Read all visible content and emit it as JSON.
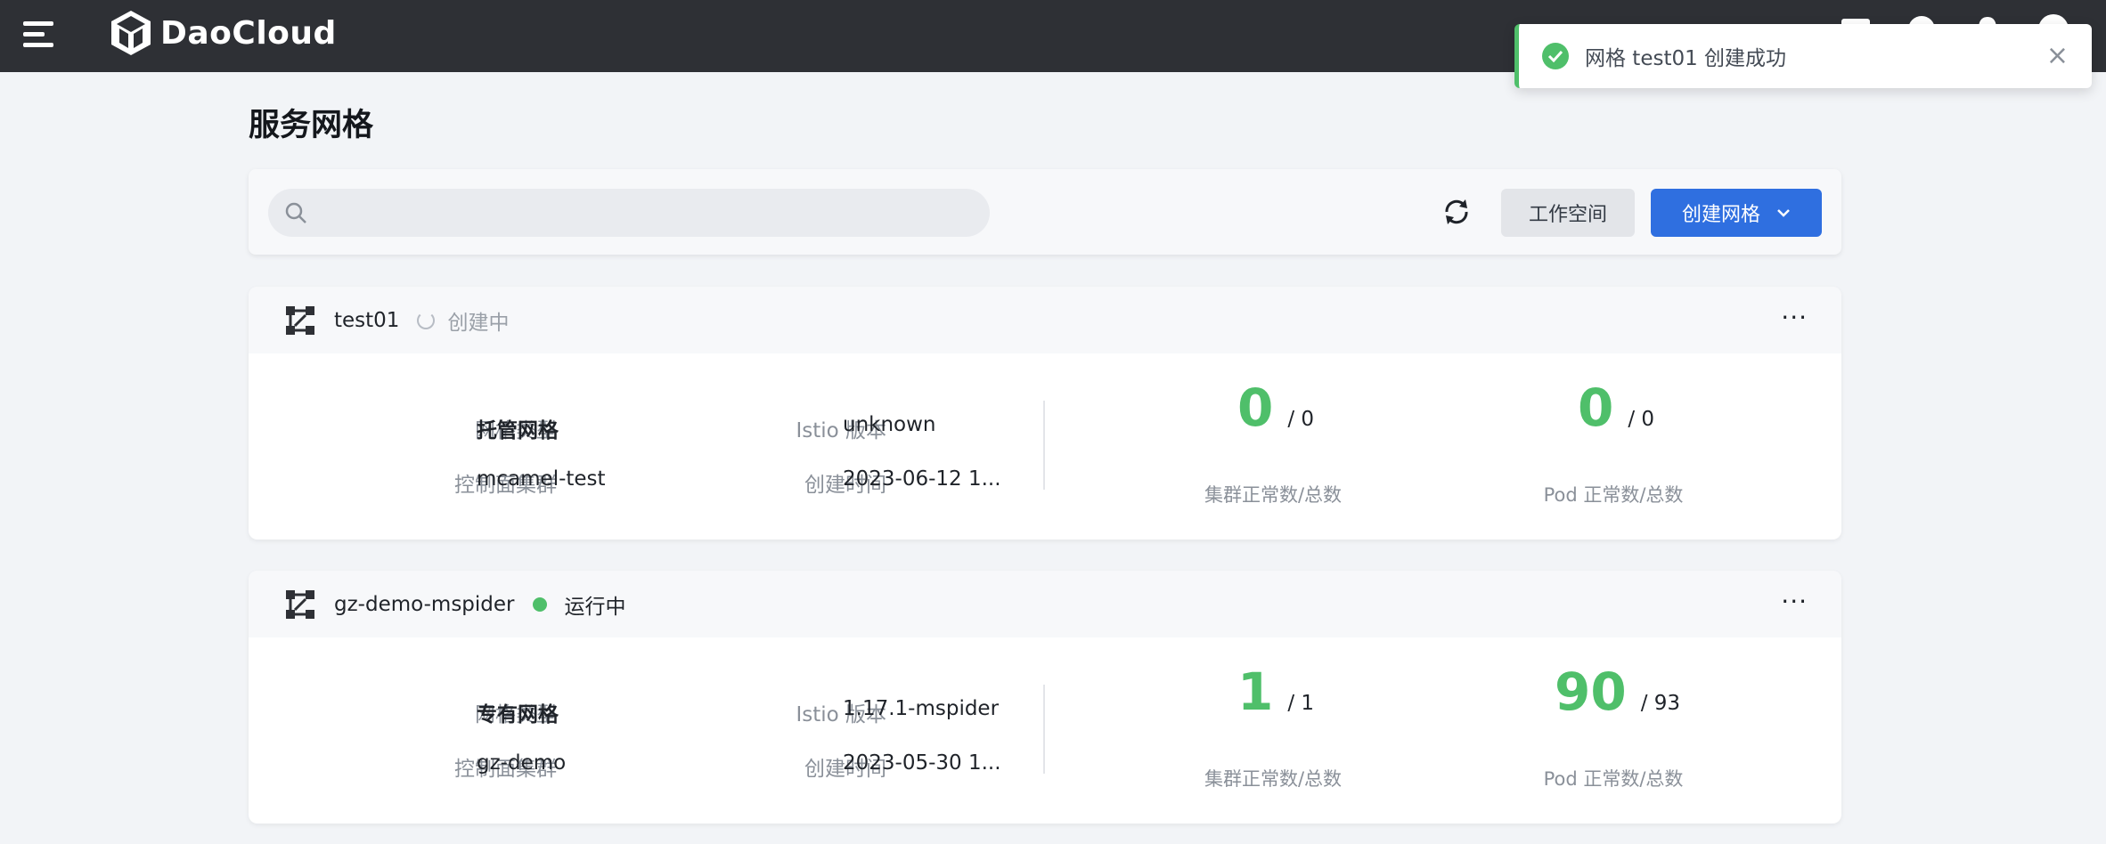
{
  "app": {
    "logo_text": "DaoCloud",
    "icons": [
      "menu-icon",
      "message-icon",
      "help-icon",
      "notification-icon",
      "user-avatar-icon"
    ]
  },
  "toast": {
    "message": "网格 test01 创建成功",
    "close": "×",
    "icon": "check-circle-icon"
  },
  "page": {
    "title": "服务网格"
  },
  "toolbar": {
    "search_placeholder": "",
    "workspace_label": "工作空间",
    "create_label": "创建网格",
    "refresh_icon": "refresh-icon"
  },
  "labels": {
    "mesh_type": "网格类型",
    "istio_version": "Istio 版本",
    "control_cluster": "控制面集群",
    "create_time": "创建时间",
    "cluster_ratio": "集群正常数/总数",
    "pod_ratio": "Pod 正常数/总数"
  },
  "meshes": [
    {
      "name": "test01",
      "status": "创建中",
      "mesh_type": "托管网格",
      "istio_version": "unknown",
      "control_cluster": "mcamel-test",
      "create_time": "2023-06-12 1...",
      "cluster_ok": "0",
      "cluster_total": "/ 0",
      "pod_ok": "0",
      "pod_total": "/ 0"
    },
    {
      "name": "gz-demo-mspider",
      "status": "运行中",
      "mesh_type": "专有网格",
      "istio_version": "1.17.1-mspider",
      "control_cluster": "gz-demo",
      "create_time": "2023-05-30 1...",
      "cluster_ok": "1",
      "cluster_total": "/ 1",
      "pod_ok": "90",
      "pod_total": "/ 93"
    }
  ],
  "colors": {
    "topbar": "#2e3035",
    "primary": "#2f6fe0",
    "success": "#4fbf6a"
  }
}
